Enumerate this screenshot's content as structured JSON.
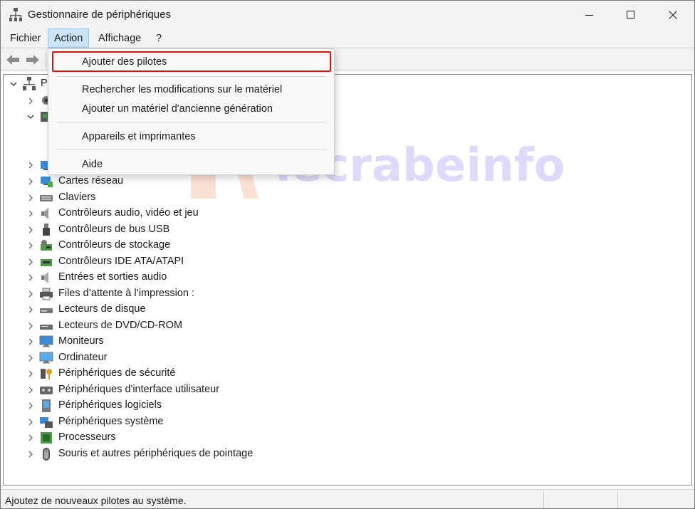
{
  "window": {
    "title": "Gestionnaire de périphériques",
    "icon": "device-manager-icon"
  },
  "controls": {
    "minimize": "minimize-icon",
    "maximize": "maximize-icon",
    "close": "close-icon"
  },
  "menubar": {
    "items": [
      {
        "label": "Fichier",
        "active": false
      },
      {
        "label": "Action",
        "active": true
      },
      {
        "label": "Affichage",
        "active": false
      },
      {
        "label": "?",
        "active": false
      }
    ]
  },
  "toolbar": {
    "back": "back-arrow-icon",
    "forward": "forward-arrow-icon"
  },
  "action_menu": {
    "items": [
      {
        "label": "Ajouter des pilotes",
        "highlighted": true
      },
      {
        "label": "Rechercher les modifications sur le matériel",
        "highlighted": false
      },
      {
        "label": "Ajouter un matériel d'ancienne génération",
        "highlighted": false
      },
      {
        "label": "Appareils et imprimantes",
        "highlighted": false
      },
      {
        "label": "Aide",
        "highlighted": false
      }
    ],
    "highlight_color": "#d8141b"
  },
  "tree": {
    "root_label_partial": "P",
    "categories": [
      {
        "label": "Cartes réseau",
        "icon": "network-adapter-icon"
      },
      {
        "label": "Claviers",
        "icon": "keyboard-icon"
      },
      {
        "label": "Contrôleurs audio, vidéo et jeu",
        "icon": "speaker-icon"
      },
      {
        "label": "Contrôleurs de bus USB",
        "icon": "usb-icon"
      },
      {
        "label": "Contrôleurs de stockage",
        "icon": "storage-controller-icon"
      },
      {
        "label": "Contrôleurs IDE ATA/ATAPI",
        "icon": "ide-controller-icon"
      },
      {
        "label": "Entrées et sorties audio",
        "icon": "audio-io-icon"
      },
      {
        "label": "Files d’attente à l’impression :",
        "icon": "printer-icon"
      },
      {
        "label": "Lecteurs de disque",
        "icon": "disk-drive-icon"
      },
      {
        "label": "Lecteurs de DVD/CD-ROM",
        "icon": "dvd-drive-icon"
      },
      {
        "label": "Moniteurs",
        "icon": "monitor-icon"
      },
      {
        "label": "Ordinateur",
        "icon": "computer-icon"
      },
      {
        "label": "Périphériques de sécurité",
        "icon": "security-device-icon"
      },
      {
        "label": "Périphériques d'interface utilisateur",
        "icon": "hid-icon"
      },
      {
        "label": "Périphériques logiciels",
        "icon": "software-device-icon"
      },
      {
        "label": "Périphériques système",
        "icon": "system-device-icon"
      },
      {
        "label": "Processeurs",
        "icon": "processor-icon"
      },
      {
        "label": "Souris et autres périphériques de pointage",
        "icon": "mouse-icon"
      }
    ]
  },
  "watermark": {
    "text": "lecrabeinfo"
  },
  "statusbar": {
    "text": "Ajoutez de nouveaux pilotes au système."
  }
}
